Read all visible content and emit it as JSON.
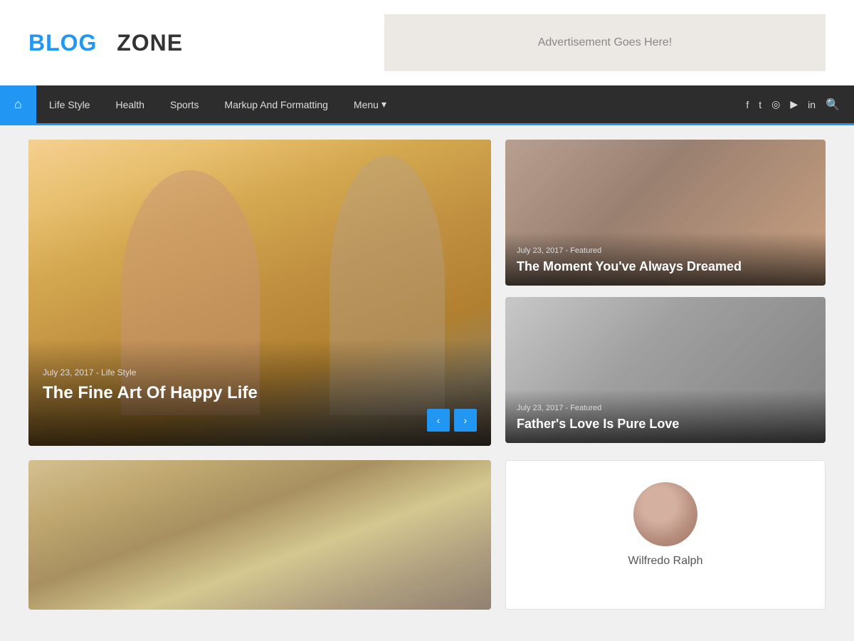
{
  "header": {
    "logo_blue": "BLOG",
    "logo_dark": "ZONE",
    "ad_text": "Advertisement Goes Here!"
  },
  "nav": {
    "home_icon": "⌂",
    "items": [
      {
        "label": "Life Style",
        "id": "lifestyle"
      },
      {
        "label": "Health",
        "id": "health"
      },
      {
        "label": "Sports",
        "id": "sports"
      },
      {
        "label": "Markup And Formatting",
        "id": "markup"
      },
      {
        "label": "Menu",
        "id": "menu"
      }
    ],
    "social_icons": [
      "f",
      "t",
      "ig",
      "yt",
      "in"
    ],
    "search": "🔍"
  },
  "featured_main": {
    "meta": "July 23, 2017 - Life Style",
    "title": "The Fine Art Of Happy Life"
  },
  "featured_top_right": {
    "meta": "July 23, 2017 - Featured",
    "title": "The Moment You've Always Dreamed"
  },
  "featured_bottom_right": {
    "meta": "July 23, 2017 - Featured",
    "title": "Father's Love Is Pure Love"
  },
  "slider": {
    "prev": "‹",
    "next": "›"
  },
  "author": {
    "name": "Wilfredo Ralph"
  }
}
